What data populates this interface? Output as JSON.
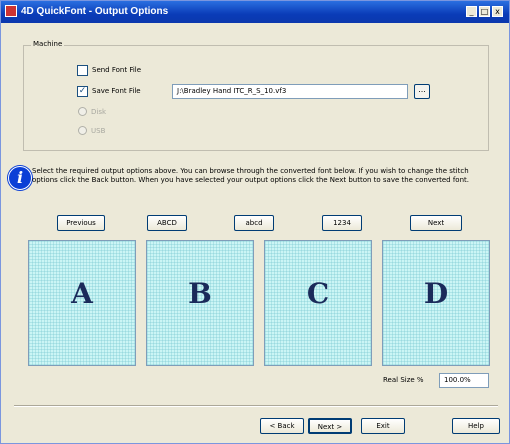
{
  "window": {
    "title": "4D QuickFont - Output Options"
  },
  "titlebar": {
    "minimize": "_",
    "maximize": "□",
    "close": "x"
  },
  "machine": {
    "group_label": "Machine",
    "send_font_file": {
      "label": "Send Font File",
      "checked": false
    },
    "save_font_file": {
      "label": "Save Font File",
      "checked": true,
      "check_mark": "✓"
    },
    "file_path": "J:\\Bradley Hand ITC_R_S_10.vf3",
    "browse_label": "...",
    "disk_label": "Disk",
    "usb_label": "USB"
  },
  "info": {
    "icon_glyph": "i",
    "text": "Select the required output options above. You can browse through the converted font below. If you wish to change the stitch options click the Back button. When you have selected your output options click the Next button to save the converted font."
  },
  "preview_nav": {
    "previous": "Previous",
    "upper": "ABCD",
    "lower": "abcd",
    "digits": "1234",
    "next": "Next"
  },
  "preview": {
    "glyphs": [
      "A",
      "B",
      "C",
      "D"
    ]
  },
  "real_size": {
    "label": "Real Size %",
    "value": "100.0%"
  },
  "footer": {
    "back": "< Back",
    "next": "Next >",
    "exit": "Exit",
    "help": "Help"
  },
  "colors": {
    "title_bar": "#0a3cb8",
    "preview_bg": "#cbf5f5",
    "info_icon": "#0b3fd6"
  }
}
